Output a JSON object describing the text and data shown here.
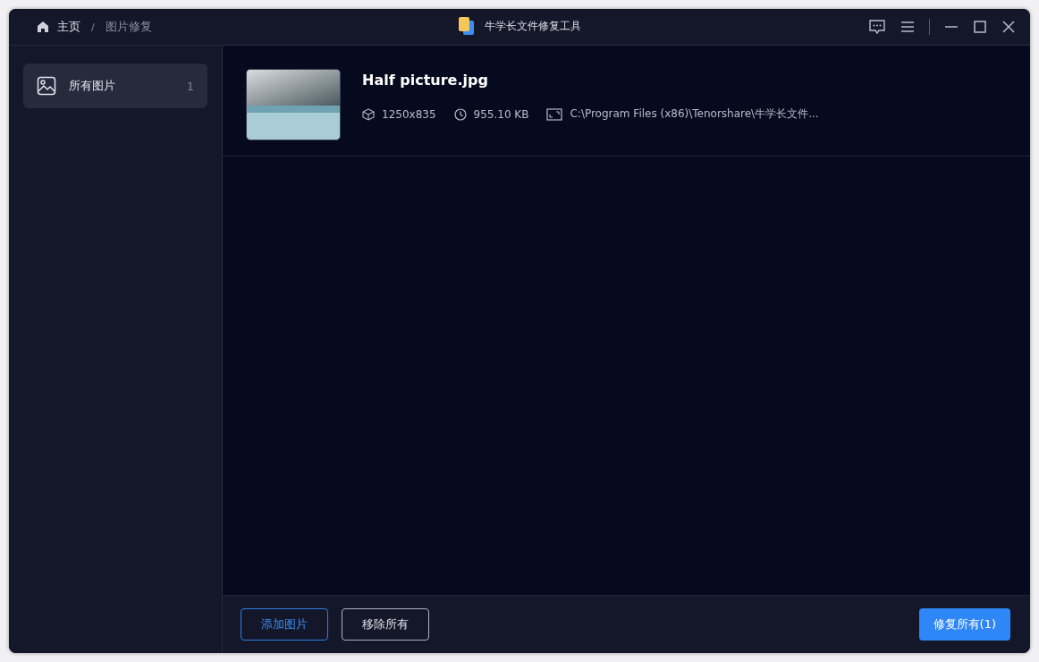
{
  "breadcrumb": {
    "home": "主页",
    "separator": "/",
    "current": "图片修复"
  },
  "window": {
    "title": "牛学长文件修复工具"
  },
  "sidebar": {
    "items": [
      {
        "label": "所有图片",
        "count": "1",
        "selected": true
      }
    ]
  },
  "files": [
    {
      "name": "Half picture.jpg",
      "dimensions": "1250x835",
      "size": "955.10 KB",
      "path": "C:\\Program Files (x86)\\Tenorshare\\牛学长文件..."
    }
  ],
  "footer": {
    "add_button": "添加图片",
    "remove_button": "移除所有",
    "repair_button": "修复所有(1)"
  }
}
